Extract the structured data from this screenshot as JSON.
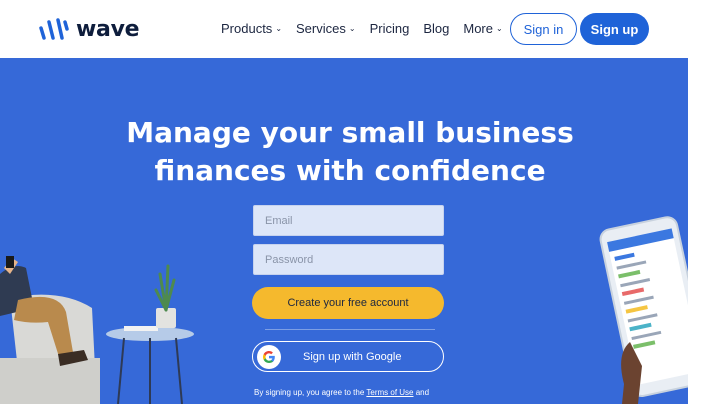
{
  "brand": {
    "name": "wave"
  },
  "nav": {
    "items": [
      {
        "label": "Products",
        "has_dropdown": true
      },
      {
        "label": "Services",
        "has_dropdown": true
      },
      {
        "label": "Pricing",
        "has_dropdown": false
      },
      {
        "label": "Blog",
        "has_dropdown": false
      },
      {
        "label": "More",
        "has_dropdown": true
      }
    ],
    "signin_label": "Sign in",
    "signup_label": "Sign up"
  },
  "hero": {
    "headline_line1": "Manage your small business",
    "headline_line2": "finances with confidence",
    "email_placeholder": "Email",
    "password_placeholder": "Password",
    "cta_label": "Create your free account",
    "google_label": "Sign up with Google",
    "terms_prefix": "By signing up, you agree to the ",
    "terms_link": "Terms of Use",
    "terms_suffix": " and"
  },
  "colors": {
    "brand_blue": "#1f63d8",
    "hero_blue": "#3669d8",
    "cta_yellow": "#f5b92d",
    "logo_dark": "#0e1d3c"
  },
  "icons": [
    "wave-logo-icon",
    "chevron-down-icon",
    "google-g-icon"
  ]
}
